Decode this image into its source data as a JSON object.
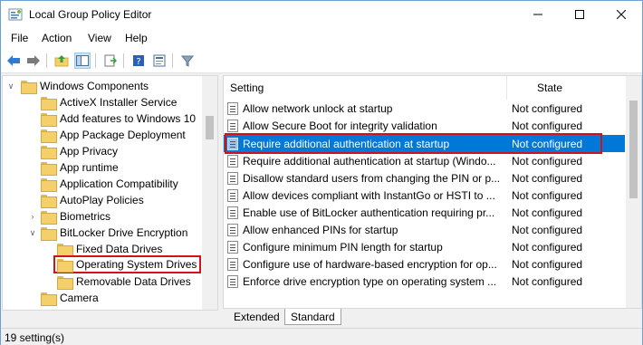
{
  "window": {
    "title": "Local Group Policy Editor"
  },
  "menu": [
    "File",
    "Action",
    "View",
    "Help"
  ],
  "toolbar": {
    "buttons": [
      "back-icon",
      "forward-icon",
      "up-folder-icon",
      "show-hide-tree-icon",
      "export-list-icon",
      "help-icon",
      "properties-view-icon",
      "filter-icon"
    ]
  },
  "tree": {
    "root": "Windows Components",
    "items": [
      "ActiveX Installer Service",
      "Add features to Windows 10",
      "App Package Deployment",
      "App Privacy",
      "App runtime",
      "Application Compatibility",
      "AutoPlay Policies",
      "Biometrics",
      "BitLocker Drive Encryption",
      "Fixed Data Drives",
      "Operating System Drives",
      "Removable Data Drives",
      "Camera"
    ]
  },
  "list": {
    "headers": {
      "setting": "Setting",
      "state": "State"
    },
    "rows": [
      {
        "setting": "Allow network unlock at startup",
        "state": "Not configured"
      },
      {
        "setting": "Allow Secure Boot for integrity validation",
        "state": "Not configured"
      },
      {
        "setting": "Require additional authentication at startup",
        "state": "Not configured"
      },
      {
        "setting": "Require additional authentication at startup (Windo...",
        "state": "Not configured"
      },
      {
        "setting": "Disallow standard users from changing the PIN or p...",
        "state": "Not configured"
      },
      {
        "setting": "Allow devices compliant with InstantGo or HSTI to ...",
        "state": "Not configured"
      },
      {
        "setting": "Enable use of BitLocker authentication requiring pr...",
        "state": "Not configured"
      },
      {
        "setting": "Allow enhanced PINs for startup",
        "state": "Not configured"
      },
      {
        "setting": "Configure minimum PIN length for startup",
        "state": "Not configured"
      },
      {
        "setting": "Configure use of hardware-based encryption for op...",
        "state": "Not configured"
      },
      {
        "setting": "Enforce drive encryption type on operating system ...",
        "state": "Not configured"
      }
    ],
    "selected_index": 2
  },
  "tabs": {
    "extended": "Extended",
    "standard": "Standard"
  },
  "status": {
    "text": "19 setting(s)"
  },
  "colors": {
    "selection": "#0078d7",
    "highlight_box": "#d0121b",
    "folder": "#f5cf6a"
  }
}
